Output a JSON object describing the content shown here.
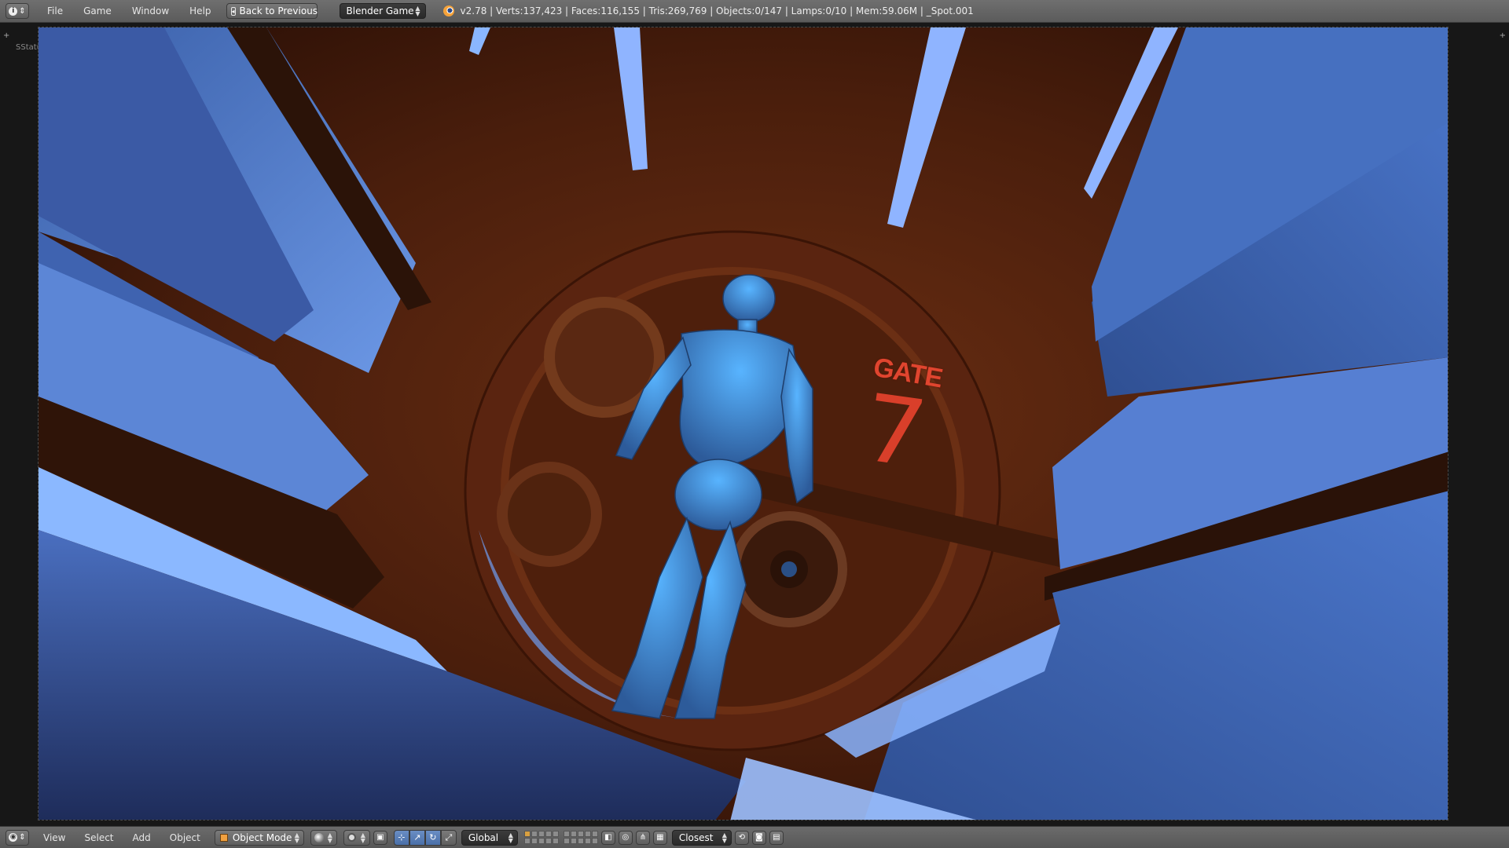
{
  "top_header": {
    "editor_icon": "info-icon",
    "menus": [
      "File",
      "Game",
      "Window",
      "Help"
    ],
    "back_button": "Back to Previous",
    "engine": "Blender Game",
    "stats": "v2.78 | Verts:137,423 | Faces:116,155 | Tris:269,769 | Objects:0/147 | Lamps:0/10 | Mem:59.06M | _Spot.001"
  },
  "viewport": {
    "status_text": "SStatus: UNDEFINED",
    "scene_sign": {
      "word": "GATE",
      "number": "7"
    }
  },
  "bottom_header": {
    "editor_icon": "view3d-icon",
    "menus": [
      "View",
      "Select",
      "Add",
      "Object"
    ],
    "mode": "Object Mode",
    "orientation": "Global",
    "snap_element": "Closest",
    "manipulator_widgets": [
      "manipulator-toggle-icon",
      "translate-icon",
      "rotate-icon",
      "scale-icon"
    ]
  },
  "colors": {
    "header_bg": "#5f5f5f",
    "scene_blue": "#4a78d0",
    "scene_rust": "#5c2612",
    "gate_red": "#e0452f"
  }
}
